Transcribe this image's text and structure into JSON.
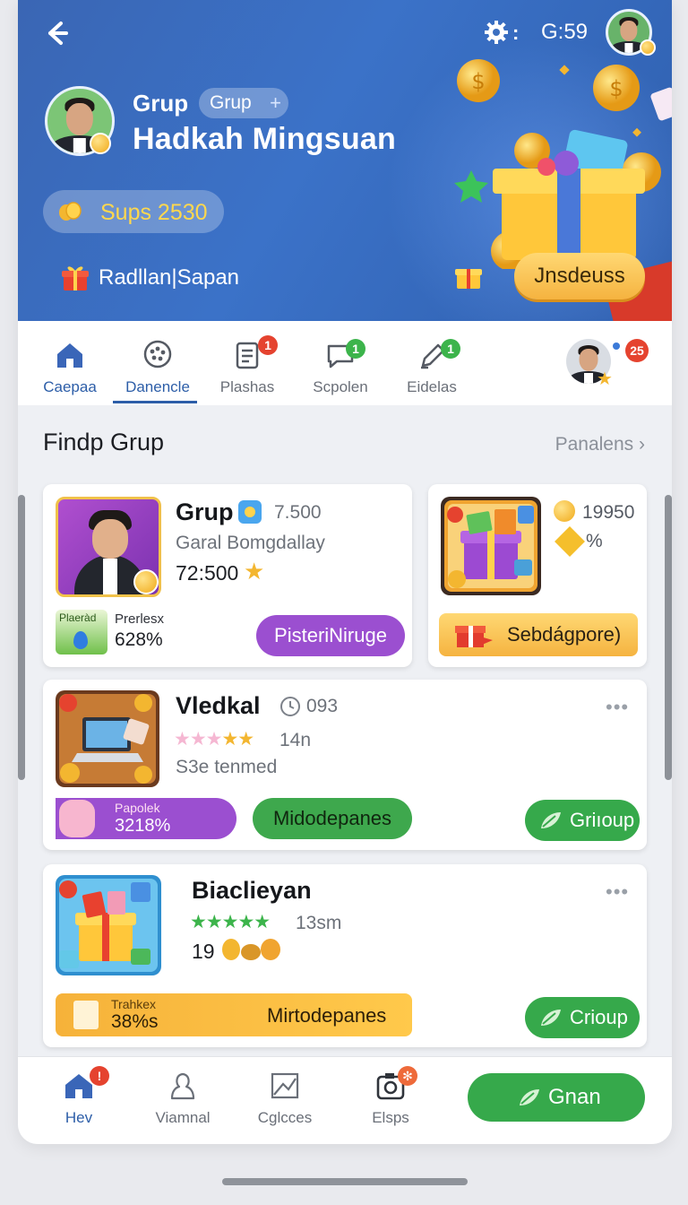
{
  "header": {
    "time": "G:59",
    "group_label": "Grup",
    "group_pill": "Grup",
    "group_pill_plus": "+",
    "user_name": "Hadkah Mingsuan",
    "coins_label": "Sups 2530",
    "sub_label": "Radllan|Sapan",
    "promo_button": "Jnsdeuss"
  },
  "tabs": [
    {
      "label": "Caepaa",
      "icon": "home-icon",
      "active": false
    },
    {
      "label": "Danencle",
      "icon": "chat-dots-icon",
      "active": true
    },
    {
      "label": "Plashas",
      "icon": "document-icon",
      "badge": "1"
    },
    {
      "label": "Scpolen",
      "icon": "message-icon",
      "badge": "1"
    },
    {
      "label": "Eidelas",
      "icon": "pencil-icon",
      "badge": "1"
    }
  ],
  "tab_avatar_badge": "25",
  "section": {
    "title": "Findp Grup",
    "link": "Panalens",
    "link_chevron": "›"
  },
  "cards": {
    "featured": {
      "title": "Grup",
      "count": "7.500",
      "subtitle": "Garal Bomgdallay",
      "amount": "72:500",
      "tag_label": "Plaeràd",
      "tag_sub": "Prerlesx",
      "tag_value": "628%",
      "tag_value_prefix": "6",
      "button": "PisteriNiruge"
    },
    "side": {
      "count": "19950",
      "percent": "%",
      "button": "Sebdágpore)"
    },
    "second": {
      "title": "Vledkal",
      "count": "093",
      "rating_count": "14n",
      "subtitle": "S3e tenmed",
      "promo_label": "Papolek",
      "promo_value": "3218%",
      "mid_button": "Midodepanes",
      "action_button": "Griıoup",
      "more": "•••"
    },
    "third": {
      "title": "Biaclieyan",
      "rating_count": "13sm",
      "coins": "19",
      "promo_label": "Trahkex",
      "promo_value": "38%s",
      "mid_button": "Mirtodepanes",
      "action_button": "Crioup",
      "more": "•••"
    }
  },
  "bottom_nav": [
    {
      "label": "Hev",
      "icon": "house-icon",
      "active": true
    },
    {
      "label": "Viamnal",
      "icon": "person-icon"
    },
    {
      "label": "Cglcces",
      "icon": "image-icon"
    },
    {
      "label": "Elsps",
      "icon": "camera-icon"
    }
  ],
  "bottom_button": "Gnan",
  "colors": {
    "header_blue": "#3b72c8",
    "accent_blue": "#2d5ea8",
    "green": "#36a94b",
    "purple": "#9b4fd0",
    "gold": "#f5b340",
    "badge_red": "#e5432f",
    "badge_green": "#3cb44b"
  }
}
